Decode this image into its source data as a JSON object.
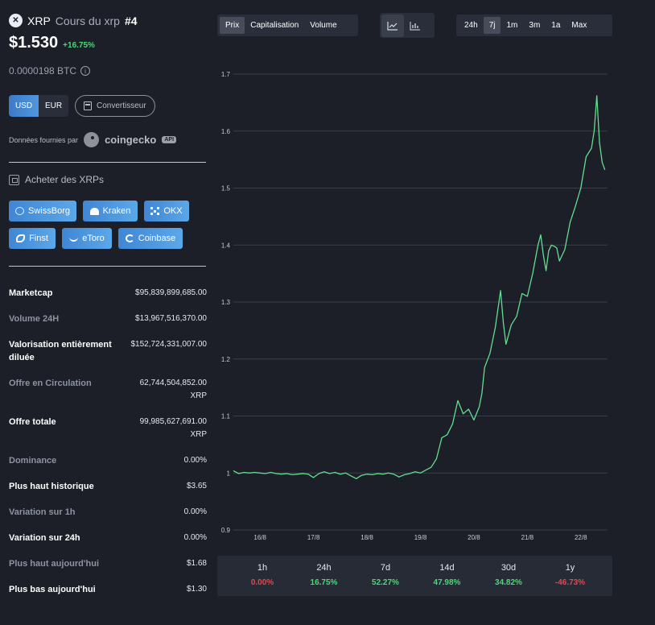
{
  "coin": {
    "logo_glyph": "✕",
    "ticker": "XRP",
    "subtitle": "Cours du xrp",
    "rank": "#4",
    "price": "$1.530",
    "change": "+16.75%",
    "btc_price": "0.0000198 BTC",
    "info_glyph": "i"
  },
  "currency": {
    "usd": "USD",
    "eur": "EUR",
    "active": "USD",
    "converter": "Convertisseur"
  },
  "provider": {
    "label": "Données fournies par",
    "name": "coingecko",
    "badge": "API"
  },
  "buy": {
    "title": "Acheter des XRPs",
    "brokers": [
      {
        "label": "SwissBorg",
        "icon": "swissborg-icon"
      },
      {
        "label": "Kraken",
        "icon": "kraken-icon"
      },
      {
        "label": "OKX",
        "icon": "okx-icon"
      },
      {
        "label": "Finst",
        "icon": "finst-icon"
      },
      {
        "label": "eToro",
        "icon": "etoro-icon"
      },
      {
        "label": "Coinbase",
        "icon": "coinbase-icon"
      }
    ]
  },
  "stats": [
    {
      "label": "Marketcap",
      "value": "$95,839,899,685.00",
      "value2": ""
    },
    {
      "label": "Volume 24H",
      "value": "$13,967,516,370.00",
      "value2": ""
    },
    {
      "label": "Valorisation entièrement",
      "label2": "diluée",
      "value": "$152,724,331,007.00",
      "value2": ""
    },
    {
      "label": "Offre en Circulation",
      "value": "62,744,504,852.00",
      "value2": "XRP"
    },
    {
      "label": "Offre totale",
      "value": "99,985,627,691.00",
      "value2": "XRP"
    },
    {
      "label": "Dominance",
      "value": "0.00%",
      "value2": ""
    },
    {
      "label": "Plus haut historique",
      "value": "$3.65",
      "value2": ""
    },
    {
      "label": "Variation sur 1h",
      "value": "0.00%",
      "value2": ""
    },
    {
      "label": "Variation sur 24h",
      "value": "0.00%",
      "value2": ""
    },
    {
      "label": "Plus haut aujourd'hui",
      "value": "$1.68",
      "value2": ""
    },
    {
      "label": "Plus bas aujourd'hui",
      "value": "$1.30",
      "value2": ""
    }
  ],
  "toolbar": {
    "metrics": [
      "Prix",
      "Capitalisation",
      "Volume"
    ],
    "active_metric": "Prix",
    "chart_types": [
      "line-chart-icon",
      "bar-chart-icon"
    ],
    "active_chart_type": "line-chart-icon",
    "ranges": [
      "24h",
      "7j",
      "1m",
      "3m",
      "1a",
      "Max"
    ],
    "active_range": "7j"
  },
  "colors": {
    "background": "#1c1f28",
    "line": "#62de8e",
    "positive": "#4fd67a",
    "negative": "#e0494f",
    "accent": "#3d7ac9"
  },
  "chart_data": {
    "type": "line",
    "title": "",
    "xlabel": "",
    "ylabel": "",
    "ylim": [
      0.9,
      1.7
    ],
    "y_ticks": [
      "1.7",
      "1.6",
      "1.5",
      "1.4",
      "1.3",
      "1.2",
      "1.1",
      "1",
      "0.9"
    ],
    "x_ticks": [
      "16/8",
      "17/8",
      "18/8",
      "19/8",
      "20/8",
      "21/8",
      "22/8"
    ],
    "x_tick_pos": [
      0.5,
      1.5,
      2.5,
      3.5,
      4.5,
      5.5,
      6.5
    ],
    "xlim": [
      0,
      7.0
    ],
    "grid": true,
    "series": [
      {
        "x": [
          0.0,
          0.1,
          0.2,
          0.3,
          0.4,
          0.5,
          0.6,
          0.7,
          0.8,
          0.9,
          1.0,
          1.1,
          1.2,
          1.3,
          1.4,
          1.5,
          1.6,
          1.7,
          1.8,
          1.9,
          2.0,
          2.1,
          2.2,
          2.3,
          2.4,
          2.5,
          2.6,
          2.7,
          2.8,
          2.9,
          3.0,
          3.1,
          3.2,
          3.3,
          3.4,
          3.5,
          3.6,
          3.7,
          3.8,
          3.9,
          4.0,
          4.1,
          4.2,
          4.3,
          4.4,
          4.5,
          4.6,
          4.65,
          4.7,
          4.8,
          4.9,
          5.0,
          5.05,
          5.1,
          5.2,
          5.3,
          5.4,
          5.5,
          5.6,
          5.7,
          5.75,
          5.8,
          5.85,
          5.9,
          5.95,
          6.0,
          6.05,
          6.1,
          6.2,
          6.3,
          6.4,
          6.5,
          6.6,
          6.7,
          6.75,
          6.8,
          6.85,
          6.9,
          6.95
        ],
        "y": [
          1.004,
          0.999,
          1.001,
          1.0,
          1.001,
          1.0,
          0.999,
          1.001,
          0.999,
          0.998,
          0.999,
          0.997,
          0.998,
          0.999,
          0.998,
          0.992,
          0.999,
          1.002,
          0.999,
          1.001,
          0.998,
          1.0,
          0.995,
          0.99,
          0.996,
          0.998,
          0.997,
          0.999,
          0.998,
          1.0,
          0.998,
          0.993,
          0.997,
          0.999,
          1.002,
          1.0,
          1.005,
          1.01,
          1.025,
          1.062,
          1.067,
          1.086,
          1.127,
          1.104,
          1.112,
          1.093,
          1.116,
          1.14,
          1.185,
          1.21,
          1.255,
          1.32,
          1.264,
          1.226,
          1.26,
          1.275,
          1.315,
          1.31,
          1.35,
          1.4,
          1.418,
          1.382,
          1.355,
          1.39,
          1.4,
          1.398,
          1.395,
          1.372,
          1.392,
          1.44,
          1.468,
          1.5,
          1.555,
          1.57,
          1.6,
          1.662,
          1.58,
          1.545,
          1.532
        ]
      }
    ]
  },
  "performance": [
    {
      "label": "1h",
      "value": "0.00%",
      "sign": "negative"
    },
    {
      "label": "24h",
      "value": "16.75%",
      "sign": "positive"
    },
    {
      "label": "7d",
      "value": "52.27%",
      "sign": "positive"
    },
    {
      "label": "14d",
      "value": "47.98%",
      "sign": "positive"
    },
    {
      "label": "30d",
      "value": "34.82%",
      "sign": "positive"
    },
    {
      "label": "1y",
      "value": "-46.73%",
      "sign": "negative"
    }
  ]
}
